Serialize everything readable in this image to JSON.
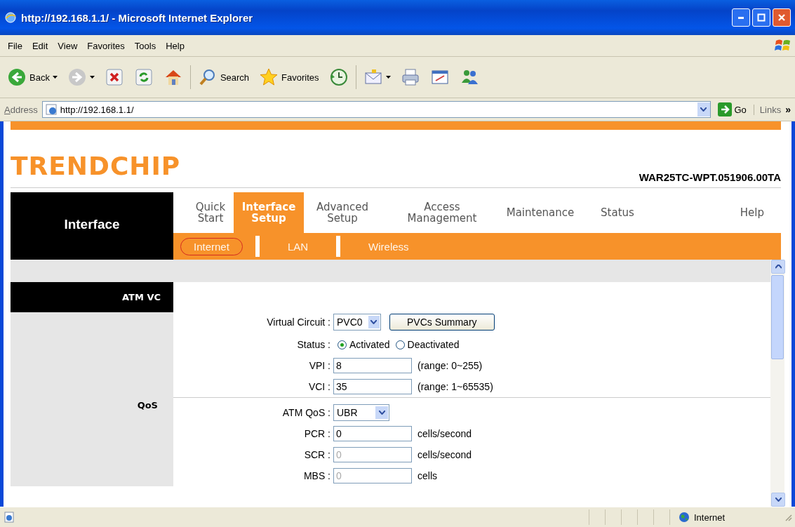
{
  "window": {
    "title": "http://192.168.1.1/ - Microsoft Internet Explorer"
  },
  "menu": [
    "File",
    "Edit",
    "View",
    "Favorites",
    "Tools",
    "Help"
  ],
  "toolbar": [
    {
      "kind": "back",
      "label": "Back",
      "dropdown": true
    },
    {
      "kind": "forward",
      "dropdown": true
    },
    {
      "kind": "stop"
    },
    {
      "kind": "refresh"
    },
    {
      "kind": "home"
    },
    {
      "kind": "search",
      "label": "Search"
    },
    {
      "kind": "favorites",
      "label": "Favorites"
    },
    {
      "kind": "history"
    },
    {
      "kind": "mail",
      "dropdown": true
    },
    {
      "kind": "print"
    },
    {
      "kind": "edit"
    },
    {
      "kind": "messenger"
    }
  ],
  "address": {
    "label": "Address",
    "value": "http://192.168.1.1/",
    "go": "Go",
    "links": "Links",
    "chevron": "»"
  },
  "page": {
    "logo": "TRENDCHIP",
    "model": "WAR25TC-WPT.051906.00TA",
    "section": "Interface",
    "nav": [
      {
        "label": "Quick Start",
        "selected": false
      },
      {
        "label": "Interface Setup",
        "selected": true
      },
      {
        "label": "Advanced Setup",
        "selected": false
      },
      {
        "label": "Access Management",
        "selected": false
      },
      {
        "label": "Maintenance",
        "selected": false
      },
      {
        "label": "Status",
        "selected": false
      },
      {
        "label": "Help",
        "selected": false
      }
    ],
    "subnav": [
      {
        "label": "Internet",
        "selected": true
      },
      {
        "label": "LAN",
        "selected": false
      },
      {
        "label": "Wireless",
        "selected": false
      }
    ],
    "sections": [
      {
        "title": "ATM VC",
        "kind": "header",
        "fields": [
          {
            "kind": "select",
            "label": "Virtual Circuit :",
            "value": "PVC0",
            "button": "PVCs Summary"
          },
          {
            "kind": "radio",
            "label": "Status :",
            "options": [
              {
                "label": "Activated",
                "selected": true
              },
              {
                "label": "Deactivated",
                "selected": false
              }
            ]
          },
          {
            "kind": "text",
            "label": "VPI :",
            "value": "8",
            "disabled": false,
            "note": "(range: 0~255)"
          },
          {
            "kind": "text",
            "label": "VCI :",
            "value": "35",
            "disabled": false,
            "note": "(range: 1~65535)"
          }
        ]
      },
      {
        "title": "QoS",
        "kind": "plain",
        "fields": [
          {
            "kind": "select",
            "label": "ATM QoS :",
            "value": "UBR"
          },
          {
            "kind": "text",
            "label": "PCR :",
            "value": "0",
            "disabled": false,
            "note": "cells/second"
          },
          {
            "kind": "text",
            "label": "SCR :",
            "value": "0",
            "disabled": true,
            "note": "cells/second"
          },
          {
            "kind": "text",
            "label": "MBS :",
            "value": "0",
            "disabled": true,
            "note": "cells"
          }
        ]
      }
    ]
  },
  "status_bar": {
    "zone": "Internet"
  }
}
